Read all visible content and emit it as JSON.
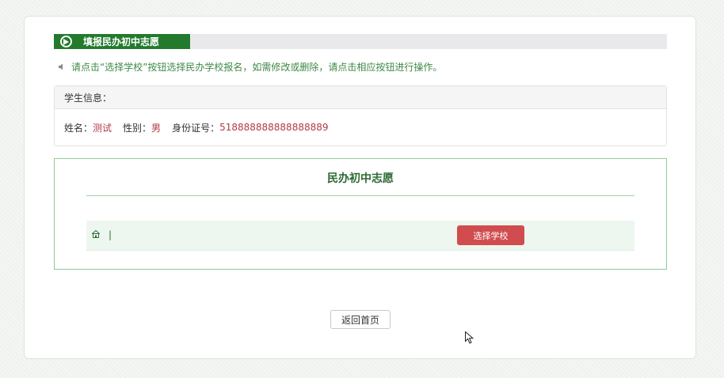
{
  "header": {
    "title": "填报民办初中志愿"
  },
  "notice": {
    "text": "请点击“选择学校”按钮选择民办学校报名，如需修改或删除，请点击相应按钮进行操作。"
  },
  "student": {
    "heading": "学生信息：",
    "name_label": "姓名：",
    "name_value": "测试",
    "gender_label": "性别：",
    "gender_value": "男",
    "id_label": "身份证号：",
    "id_value": "518888888888888889"
  },
  "wish": {
    "title": "民办初中志愿",
    "separator": "|",
    "select_button": "选择学校"
  },
  "footer": {
    "back_button": "返回首页"
  },
  "colors": {
    "brand_green": "#237a2d",
    "accent_red": "#d14c4e",
    "value_red": "#b23a46"
  }
}
